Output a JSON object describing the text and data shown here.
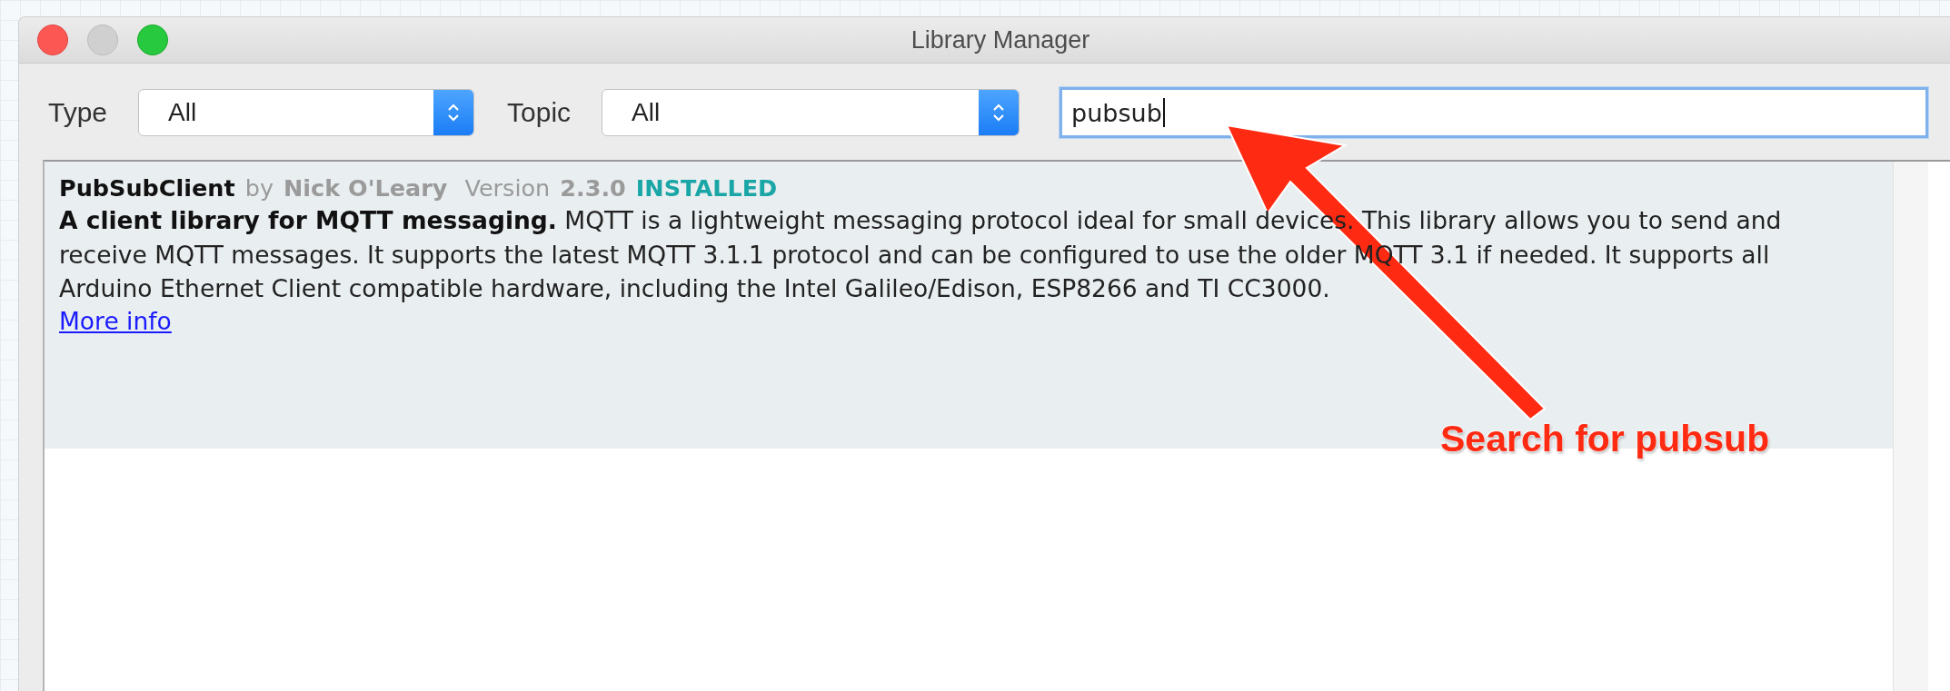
{
  "window": {
    "title": "Library Manager"
  },
  "filters": [
    {
      "label": "Type",
      "value": "All"
    },
    {
      "label": "Topic",
      "value": "All"
    }
  ],
  "search": {
    "value": "pubsub",
    "focused": true
  },
  "libraries": [
    {
      "name": "PubSubClient",
      "by_label": "by",
      "author": "Nick O'Leary",
      "version_label": "Version",
      "version": "2.3.0",
      "status": "INSTALLED",
      "description": "**A client library for MQTT messaging.** MQTT is a lightweight messaging protocol ideal for small devices. This library allows you to send and receive MQTT messages. It supports the latest MQTT 3.1.1 protocol and can be configured to use the older MQTT 3.1 if needed. It supports all Arduino Ethernet Client compatible hardware, including the Intel Galileo/Edison, ESP8266 and TI CC3000.",
      "link": "More info",
      "selected": true
    }
  ],
  "annotation": {
    "label": "Search for pubsub"
  }
}
